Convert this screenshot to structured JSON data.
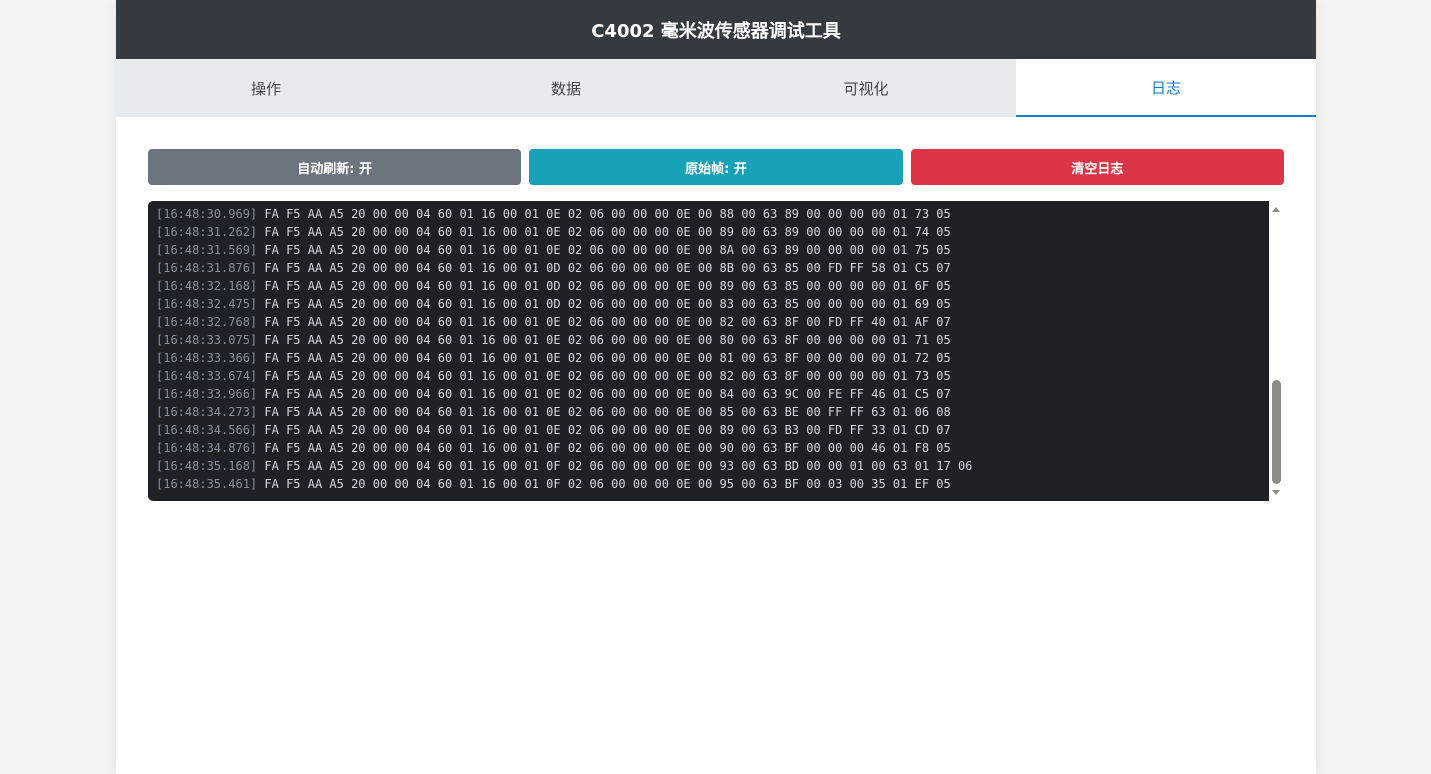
{
  "header": {
    "title": "C4002 毫米波传感器调试工具"
  },
  "tabs": [
    {
      "label": "操作",
      "active": false
    },
    {
      "label": "数据",
      "active": false
    },
    {
      "label": "可视化",
      "active": false
    },
    {
      "label": "日志",
      "active": true
    }
  ],
  "buttons": {
    "auto_refresh": "自动刷新: 开",
    "raw_frame": "原始帧: 开",
    "clear_log": "清空日志"
  },
  "colors": {
    "header_bg": "#343a40",
    "accent": "#1a7fd0",
    "btn_gray": "#6c757d",
    "btn_teal": "#17a2b8",
    "btn_red": "#dc3545",
    "log_bg": "#1e2227"
  },
  "log": [
    {
      "ts": "[16:48:30.969]",
      "hex": "FA F5 AA A5 20 00 00 04 60 01 16 00 01 0E 02 06 00 00 00 0E 00 88 00 63 89 00 00 00 00 01 73 05"
    },
    {
      "ts": "[16:48:31.262]",
      "hex": "FA F5 AA A5 20 00 00 04 60 01 16 00 01 0E 02 06 00 00 00 0E 00 89 00 63 89 00 00 00 00 01 74 05"
    },
    {
      "ts": "[16:48:31.569]",
      "hex": "FA F5 AA A5 20 00 00 04 60 01 16 00 01 0E 02 06 00 00 00 0E 00 8A 00 63 89 00 00 00 00 01 75 05"
    },
    {
      "ts": "[16:48:31.876]",
      "hex": "FA F5 AA A5 20 00 00 04 60 01 16 00 01 0D 02 06 00 00 00 0E 00 8B 00 63 85 00 FD FF 58 01 C5 07"
    },
    {
      "ts": "[16:48:32.168]",
      "hex": "FA F5 AA A5 20 00 00 04 60 01 16 00 01 0D 02 06 00 00 00 0E 00 89 00 63 85 00 00 00 00 01 6F 05"
    },
    {
      "ts": "[16:48:32.475]",
      "hex": "FA F5 AA A5 20 00 00 04 60 01 16 00 01 0D 02 06 00 00 00 0E 00 83 00 63 85 00 00 00 00 01 69 05"
    },
    {
      "ts": "[16:48:32.768]",
      "hex": "FA F5 AA A5 20 00 00 04 60 01 16 00 01 0E 02 06 00 00 00 0E 00 82 00 63 8F 00 FD FF 40 01 AF 07"
    },
    {
      "ts": "[16:48:33.075]",
      "hex": "FA F5 AA A5 20 00 00 04 60 01 16 00 01 0E 02 06 00 00 00 0E 00 80 00 63 8F 00 00 00 00 01 71 05"
    },
    {
      "ts": "[16:48:33.366]",
      "hex": "FA F5 AA A5 20 00 00 04 60 01 16 00 01 0E 02 06 00 00 00 0E 00 81 00 63 8F 00 00 00 00 01 72 05"
    },
    {
      "ts": "[16:48:33.674]",
      "hex": "FA F5 AA A5 20 00 00 04 60 01 16 00 01 0E 02 06 00 00 00 0E 00 82 00 63 8F 00 00 00 00 01 73 05"
    },
    {
      "ts": "[16:48:33.966]",
      "hex": "FA F5 AA A5 20 00 00 04 60 01 16 00 01 0E 02 06 00 00 00 0E 00 84 00 63 9C 00 FE FF 46 01 C5 07"
    },
    {
      "ts": "[16:48:34.273]",
      "hex": "FA F5 AA A5 20 00 00 04 60 01 16 00 01 0E 02 06 00 00 00 0E 00 85 00 63 BE 00 FF FF 63 01 06 08"
    },
    {
      "ts": "[16:48:34.566]",
      "hex": "FA F5 AA A5 20 00 00 04 60 01 16 00 01 0E 02 06 00 00 00 0E 00 89 00 63 B3 00 FD FF 33 01 CD 07"
    },
    {
      "ts": "[16:48:34.876]",
      "hex": "FA F5 AA A5 20 00 00 04 60 01 16 00 01 0F 02 06 00 00 00 0E 00 90 00 63 BF 00 00 00 46 01 F8 05"
    },
    {
      "ts": "[16:48:35.168]",
      "hex": "FA F5 AA A5 20 00 00 04 60 01 16 00 01 0F 02 06 00 00 00 0E 00 93 00 63 BD 00 00 01 00 63 01 17 06"
    },
    {
      "ts": "[16:48:35.461]",
      "hex": "FA F5 AA A5 20 00 00 04 60 01 16 00 01 0F 02 06 00 00 00 0E 00 95 00 63 BF 00 03 00 35 01 EF 05"
    }
  ]
}
